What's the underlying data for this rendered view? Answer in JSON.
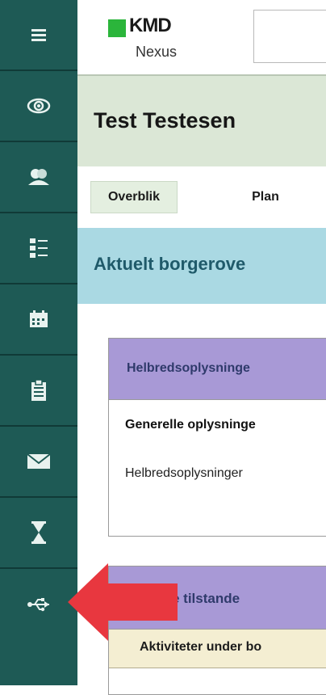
{
  "brand": {
    "logo_main": "KMD",
    "logo_sub": "Nexus",
    "logo_color": "#2bb53b"
  },
  "sidebar": {
    "background": "#1e5a55",
    "items": [
      {
        "icon": "menu-icon"
      },
      {
        "icon": "eye-icon"
      },
      {
        "icon": "users-icon"
      },
      {
        "icon": "checklist-icon"
      },
      {
        "icon": "calendar-icon"
      },
      {
        "icon": "clipboard-icon"
      },
      {
        "icon": "mail-icon"
      },
      {
        "icon": "hourglass-icon"
      },
      {
        "icon": "usb-icon"
      }
    ]
  },
  "patient": {
    "name": "Test Testesen"
  },
  "tabs": {
    "overview": "Overblik",
    "plan": "Plan"
  },
  "section": {
    "title": "Aktuelt borgerove"
  },
  "cards": {
    "health_header": "Helbredsoplysninge",
    "general_title": "Generelle oplysninge",
    "general_item": "Helbredsoplysninger",
    "conditions_header": "e tilstande",
    "activities_sub": "Aktiviteter under bo"
  },
  "annotation": {
    "arrow_color": "#e8373f"
  }
}
